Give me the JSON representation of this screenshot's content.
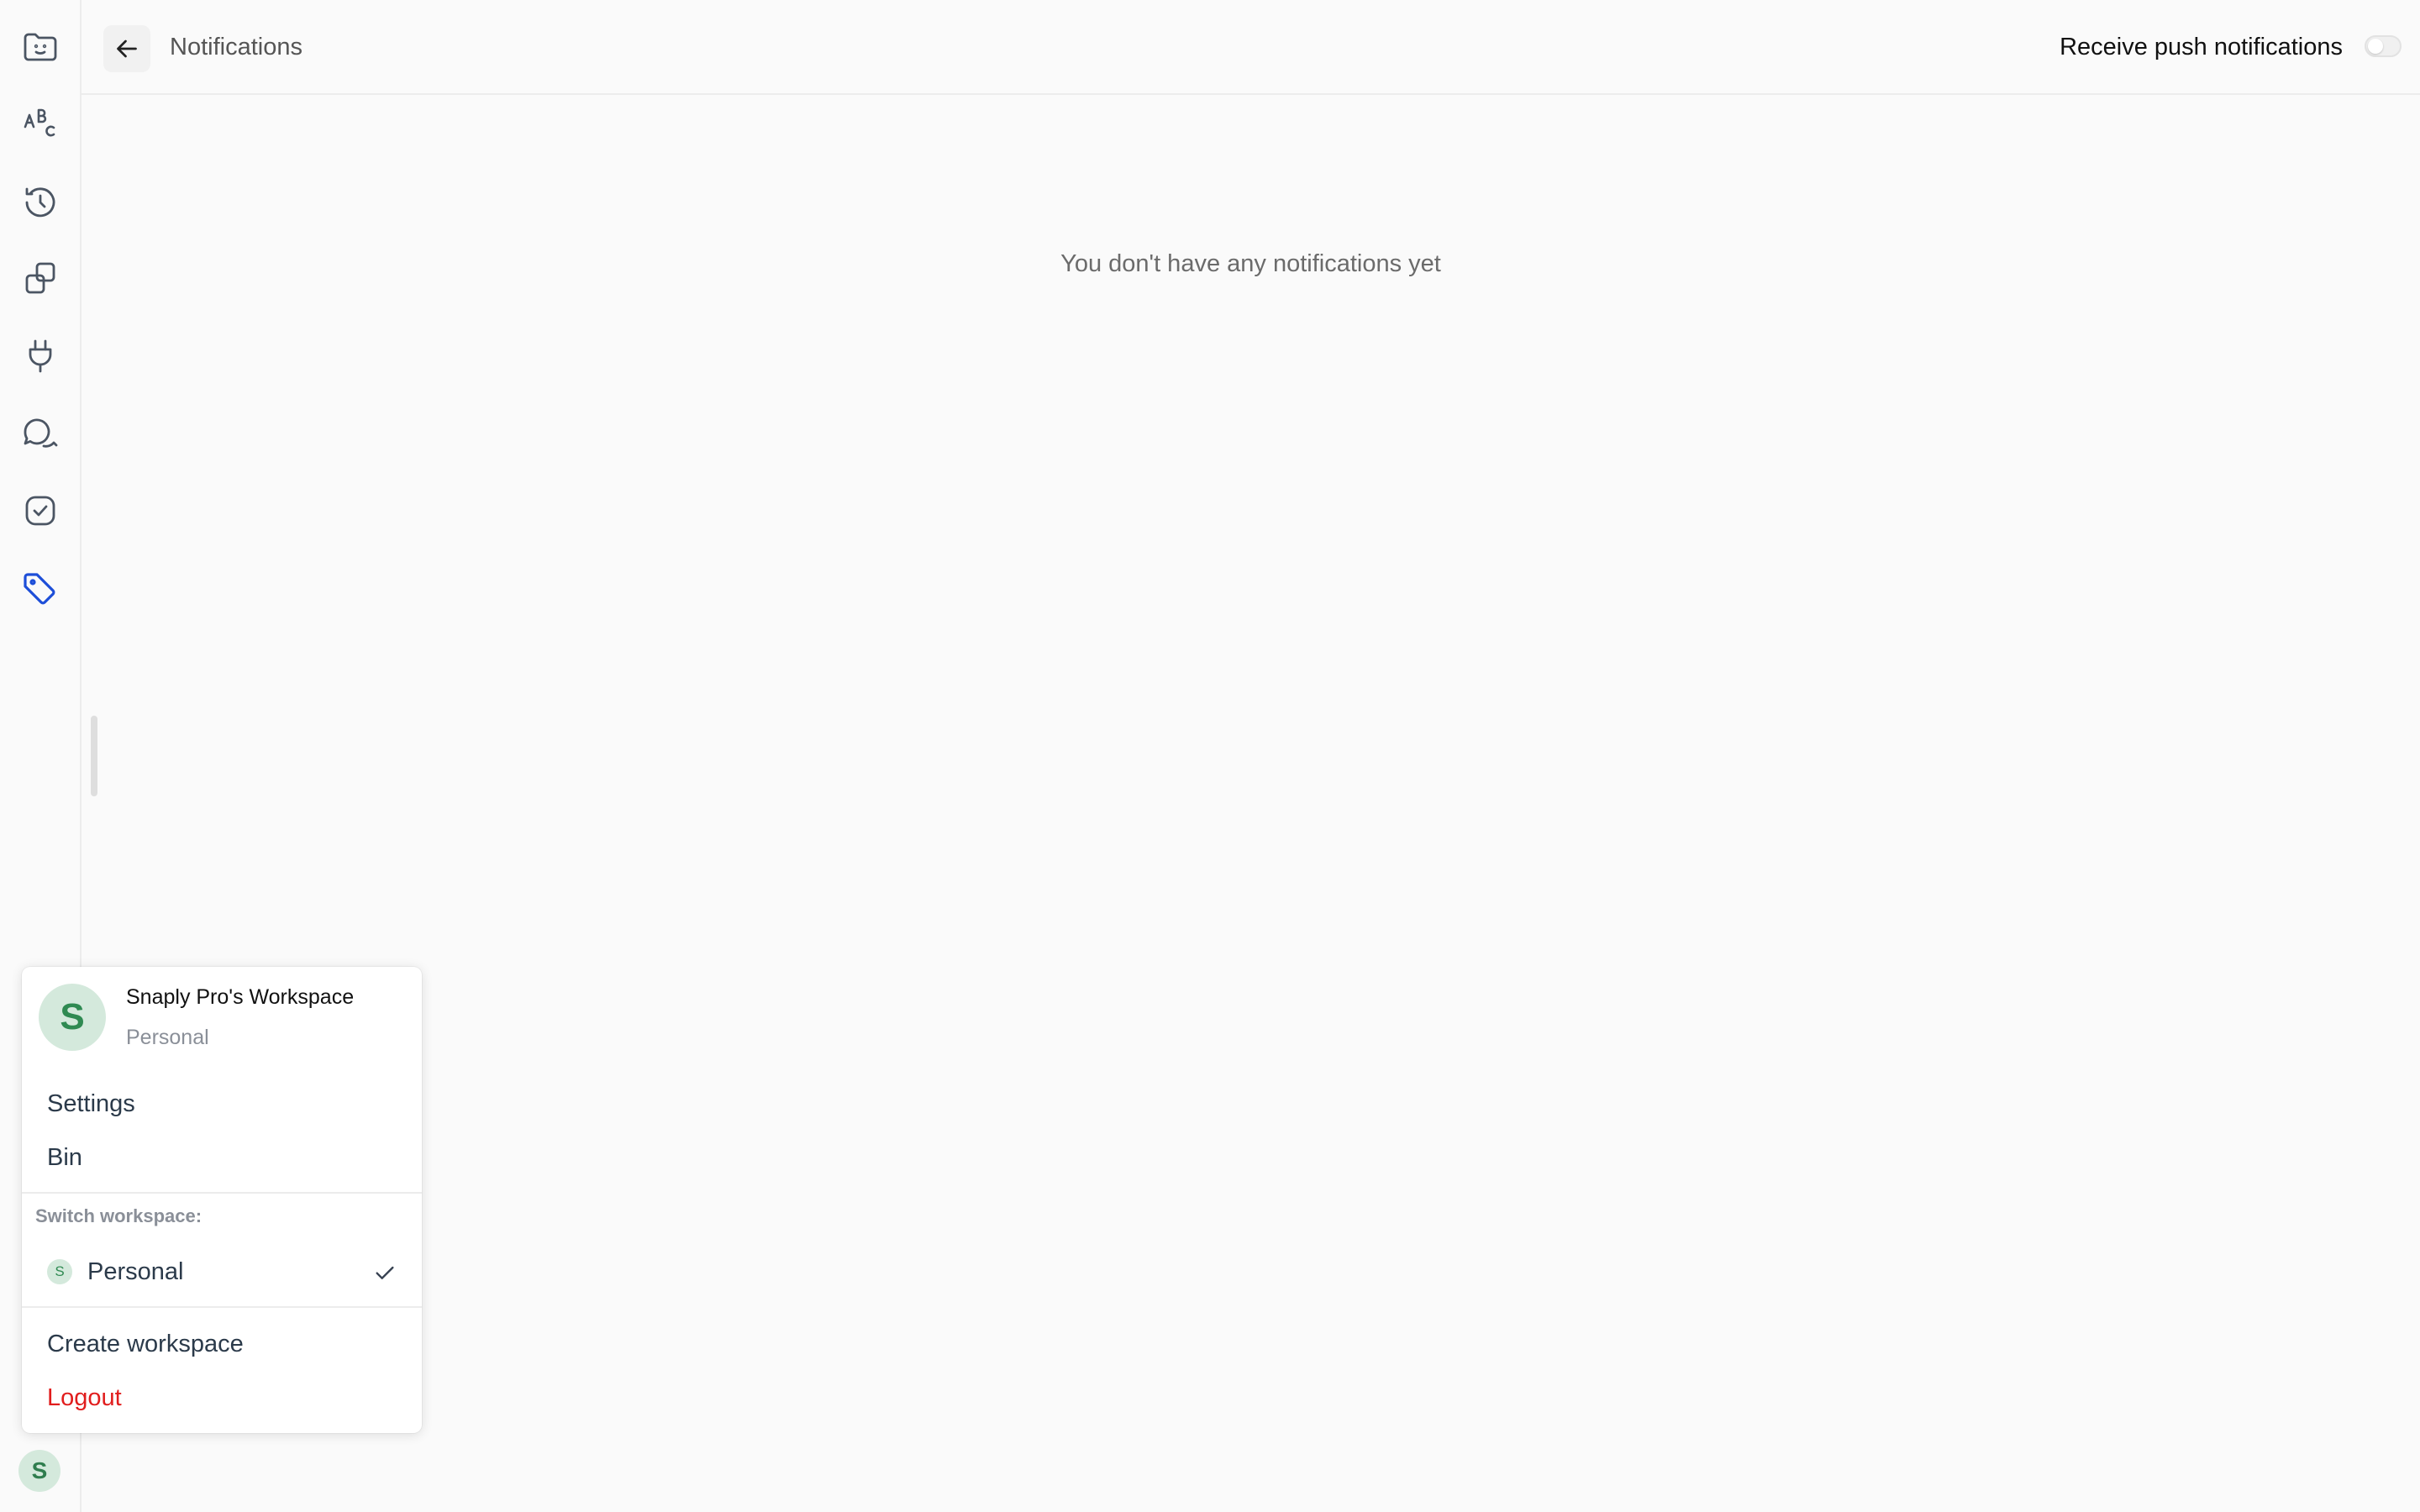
{
  "header": {
    "title": "Notifications",
    "push_label": "Receive push notifications",
    "push_enabled": false
  },
  "empty_state": {
    "message": "You don't have any notifications yet"
  },
  "sidebar": {
    "items": [
      {
        "icon": "smiley-folder-icon",
        "active": false
      },
      {
        "icon": "abc-icon",
        "active": false
      },
      {
        "icon": "history-icon",
        "active": false
      },
      {
        "icon": "copy-icon",
        "active": false
      },
      {
        "icon": "plug-icon",
        "active": false
      },
      {
        "icon": "chat-icon",
        "active": false
      },
      {
        "icon": "check-square-icon",
        "active": false
      },
      {
        "icon": "tag-icon",
        "active": true
      }
    ],
    "avatar_initial": "S"
  },
  "workspace_menu": {
    "avatar_initial": "S",
    "workspace_name": "Snaply Pro's Workspace",
    "workspace_type": "Personal",
    "items": {
      "settings": "Settings",
      "bin": "Bin"
    },
    "switch_label": "Switch workspace:",
    "workspaces": [
      {
        "initial": "S",
        "name": "Personal",
        "selected": true
      }
    ],
    "create_label": "Create workspace",
    "logout_label": "Logout"
  },
  "colors": {
    "accent": "#1d4ed8",
    "logout": "#e11d1d",
    "avatar_bg": "#d4e9dc",
    "avatar_fg": "#2f8a52"
  }
}
